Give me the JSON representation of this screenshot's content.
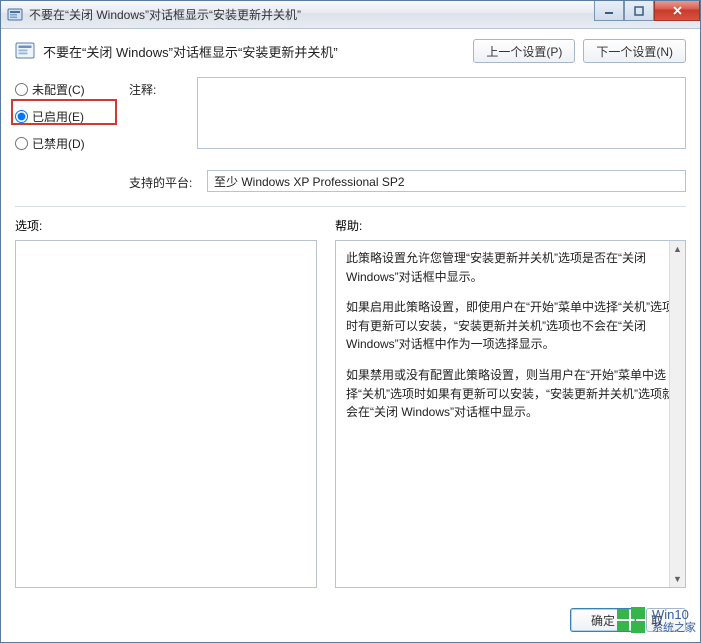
{
  "titlebar": {
    "text": "不要在“关闭 Windows”对话框显示“安装更新并关机”"
  },
  "header": {
    "title": "不要在“关闭 Windows”对话框显示“安装更新并关机”",
    "prev_btn": "上一个设置(P)",
    "next_btn": "下一个设置(N)"
  },
  "radios": {
    "not_configured": "未配置(C)",
    "enabled": "已启用(E)",
    "disabled": "已禁用(D)"
  },
  "labels": {
    "comment": "注释:",
    "platform": "支持的平台:",
    "options": "选项:",
    "help": "帮助:"
  },
  "platform": {
    "value": "至少 Windows XP Professional SP2"
  },
  "help": {
    "p1": "此策略设置允许您管理“安装更新并关机”选项是否在“关闭 Windows”对话框中显示。",
    "p2": "如果启用此策略设置，即使用户在“开始”菜单中选择“关机”选项时有更新可以安装，“安装更新并关机”选项也不会在“关闭 Windows”对话框中作为一项选择显示。",
    "p3": "如果禁用或没有配置此策略设置，则当用户在“开始”菜单中选择“关机”选项时如果有更新可以安装，“安装更新并关机”选项就会在“关闭 Windows”对话框中显示。"
  },
  "footer": {
    "ok": "确定",
    "cancel_partial": "取"
  },
  "watermark": {
    "line1": "Win10",
    "line2": "系统之家"
  }
}
